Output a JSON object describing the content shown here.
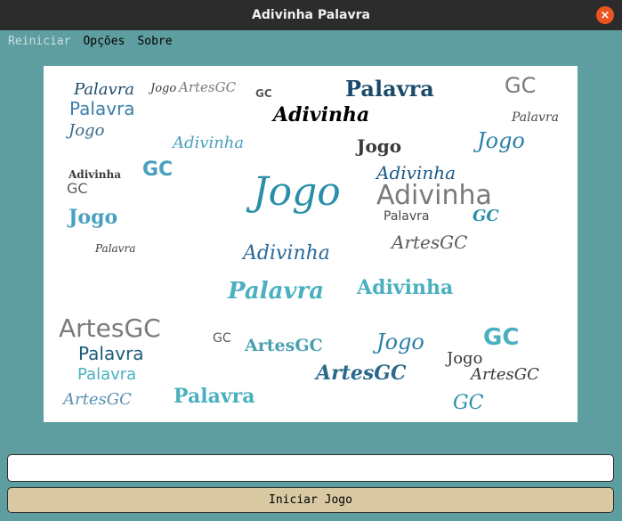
{
  "window": {
    "title": "Adivinha Palavra",
    "close_glyph": "×"
  },
  "menu": {
    "reiniciar": "Reiniciar",
    "opcoes": "Opções",
    "sobre": "Sobre"
  },
  "wordcloud": {
    "words": [
      {
        "text": "Palavra",
        "color": "#1a4a6a"
      },
      {
        "text": "Jogo",
        "color": "#3a3a3a"
      },
      {
        "text": "ArtesGC",
        "color": "#7a7a7a"
      },
      {
        "text": "GC",
        "color": "#5a5a5a"
      },
      {
        "text": "Palavra",
        "color": "#3a7fa8"
      },
      {
        "text": "Adivinha",
        "color": "#000000"
      },
      {
        "text": "Palavra",
        "color": "#1a4a6a"
      },
      {
        "text": "GC",
        "color": "#7a7a7a"
      },
      {
        "text": "Jogo",
        "color": "#3a3a3a"
      },
      {
        "text": "Adivinha",
        "color": "#4aa0c0"
      },
      {
        "text": "Jogo",
        "color": "#2a7fa8"
      },
      {
        "text": "Palavra",
        "color": "#4a4a4a"
      },
      {
        "text": "GC",
        "color": "#4aa0c0"
      },
      {
        "text": "Jogo",
        "color": "#2a8fa8"
      },
      {
        "text": "Adivinha",
        "color": "#1a5a8a"
      },
      {
        "text": "Adivinha",
        "color": "#7a7a7a"
      },
      {
        "text": "Jogo",
        "color": "#4aa0c0"
      },
      {
        "text": "Palavra",
        "color": "#4a4a4a"
      },
      {
        "text": "GC",
        "color": "#2a8fa8"
      },
      {
        "text": "ArtesGC",
        "color": "#5a5a5a"
      },
      {
        "text": "Adivinha",
        "color": "#2a6a9a"
      },
      {
        "text": "Palavra",
        "color": "#4ab0c0"
      },
      {
        "text": "Adivinha",
        "color": "#4ab0c0"
      },
      {
        "text": "ArtesGC",
        "color": "#7a7a7a"
      },
      {
        "text": "Palavra",
        "color": "#1a5a7a"
      },
      {
        "text": "ArtesGC",
        "color": "#4aa0b0"
      },
      {
        "text": "Jogo",
        "color": "#2a7fa8"
      },
      {
        "text": "GC",
        "color": "#4ab0c0"
      },
      {
        "text": "ArtesGC",
        "color": "#2a6a8a"
      },
      {
        "text": "Palavra",
        "color": "#4ab0c0"
      },
      {
        "text": "Jogo",
        "color": "#3a3a3a"
      },
      {
        "text": "Palavra",
        "color": "#4ab0c0"
      },
      {
        "text": "ArtesGC",
        "color": "#3a3a3a"
      },
      {
        "text": "GC",
        "color": "#2a8fa8"
      },
      {
        "text": "ArtesGC",
        "color": "#5a8faf"
      },
      {
        "text": "GC",
        "color": "#5a5a5a"
      },
      {
        "text": "Adivinha",
        "color": "#3a3a3a"
      },
      {
        "text": "Jogo",
        "color": "#3a6a8a"
      },
      {
        "text": "GC",
        "color": "#5a5a5a"
      },
      {
        "text": "Palavra",
        "color": "#3a3a3a"
      }
    ]
  },
  "answer_input": {
    "value": "",
    "placeholder": ""
  },
  "start_button": {
    "label": "Iniciar Jogo"
  }
}
